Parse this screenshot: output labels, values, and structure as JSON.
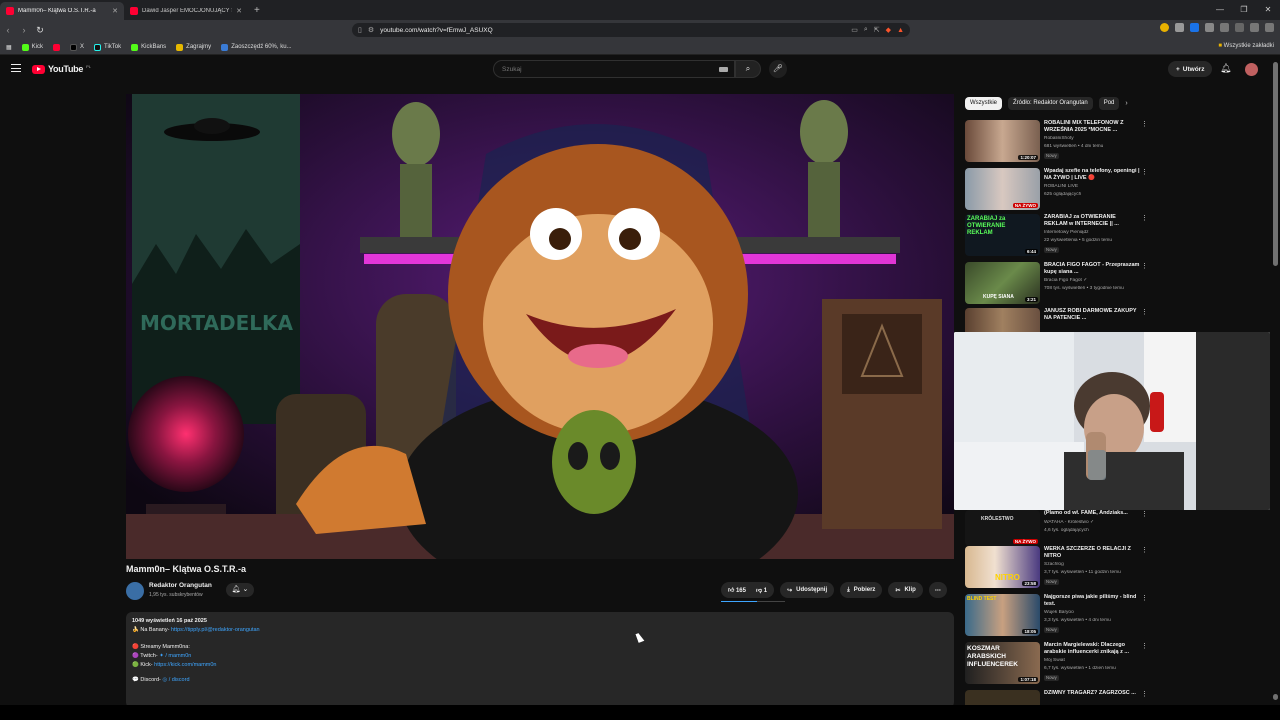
{
  "browser": {
    "tabs": [
      {
        "title": "Mamm0n– Klątwa O.S.T.R.-a",
        "active": true
      },
      {
        "title": "Dawid Jasper EMOCJONUJĄCY STUM",
        "active": false
      }
    ],
    "url": "youtube.com/watch?v=fEmwJ_ASUXQ",
    "bookmarks": [
      "Kick",
      "X",
      "TikTok",
      "KickBans",
      "Zagrajmy",
      "Zaoszczędź 60%, ku..."
    ],
    "bookmarks_all": "Wszystkie zakładki"
  },
  "youtube": {
    "logo": "YouTube",
    "logo_cc": "PL",
    "search_placeholder": "Szukaj",
    "create_label": "Utwórz"
  },
  "video": {
    "title": "Mamm0n– Klątwa O.S.T.R.-a",
    "channel": "Redaktor Orangutan",
    "subs": "1,95 tys. subskrybentów",
    "likes": "165",
    "dislikes": "1",
    "share": "Udostępnij",
    "download": "Pobierz",
    "clip": "Klip",
    "thumbnail_sign": "MORTADELKA",
    "description": {
      "stats": "1049 wyświetleń  16 paź 2025",
      "line1_label": "🍌 Na Banany- ",
      "line1_link": "https://tipply.pl/@redaktor-orangutan",
      "line2": "🔴 Streamy Mamm0na:",
      "line3_label": "🟣 Twitch- ",
      "line3_link": "✦ / mamm0n",
      "line4_label": "🟢 Kick- ",
      "line4_link": "https://kick.com/mamm0n",
      "line5_label": "💬 Discord- ",
      "line5_link": "◎ / discord"
    }
  },
  "chips": [
    "Wszystkie",
    "Źródło: Redaktor Orangutan",
    "Pod"
  ],
  "related": [
    {
      "title": "ROBALINI MIX TELEFONÓW Z WRZEŚNIA 2025 *MOCNE ...",
      "channel": "RobaliniShoty",
      "views": "681 wyświetleń • 4 dni temu",
      "badge": "Nowy",
      "duration": "1:20:07",
      "live": ""
    },
    {
      "title": "Wpadaj szefie na telefony, openingi | NA ŻYWO | LIVE 🔴",
      "channel": "ROBALINI LIVE",
      "views": "625 oglądających",
      "badge": "",
      "duration": "",
      "live": "NA ŻYWO"
    },
    {
      "title": "ZARABIAJ za OTWIERANIE REKLAM w INTERNECIE || ...",
      "channel": "Internetowy Pieniądz",
      "views": "22 wyświetlenia • 5 godzin temu",
      "badge": "Nowy",
      "duration": "6:44",
      "live": ""
    },
    {
      "title": "BRACIA FIGO FAGOT - Przepraszam kupę siana ...",
      "channel": "Bracia Figo Fagot ✓",
      "views": "708 tys. wyświetleń • 3 tygodnie temu",
      "badge": "",
      "duration": "3:21",
      "live": ""
    },
    {
      "title": "JANUSZ ROBI DARMOWE ZAKUPY NA PATENCIE ...",
      "channel": "",
      "views": "",
      "badge": "",
      "duration": "",
      "live": ""
    },
    {
      "title": "(Plamo od wł. FAME, Andziaks...",
      "channel": "WATAHA - Królestwo ✓",
      "views": "4,6 tys. oglądających",
      "badge": "",
      "duration": "",
      "live": "NA ŻYWO"
    },
    {
      "title": "WERKA SZCZERZE O RELACJI Z NITRO",
      "channel": "Szachlog",
      "views": "3,7 tys. wyświetleń • 11 godzin temu",
      "badge": "Nowy",
      "duration": "23:58",
      "live": ""
    },
    {
      "title": "Najgorsze piwa jakie piliśmy - blind test.",
      "channel": "Wujek Baryoo",
      "views": "3,3 tys. wyświetleń • 4 dni temu",
      "badge": "Nowy",
      "duration": "18:05",
      "live": ""
    },
    {
      "title": "Marcin Margielewski: Dlaczego arabskie influencerki znikają z ...",
      "channel": "Mój Świat",
      "views": "6,7 tys. wyświetleń • 1 dzień temu",
      "badge": "Nowy",
      "duration": "1:07:18",
      "live": ""
    },
    {
      "title": "DZIWNY TRAGARZ? ZAGRZOŚĆ ...",
      "channel": "",
      "views": "",
      "badge": "",
      "duration": "",
      "live": ""
    }
  ],
  "thumb_labels": {
    "r3": "ZARABIAJ za OTWIERANIE REKLAM",
    "r4": "KUPĘ SIANA",
    "r6": "KRÓLESTWO",
    "r7": "NITRO",
    "r8": "BLIND TEST",
    "r9": "KOSZMAR ARABSKICH INFLUENCEREK"
  }
}
